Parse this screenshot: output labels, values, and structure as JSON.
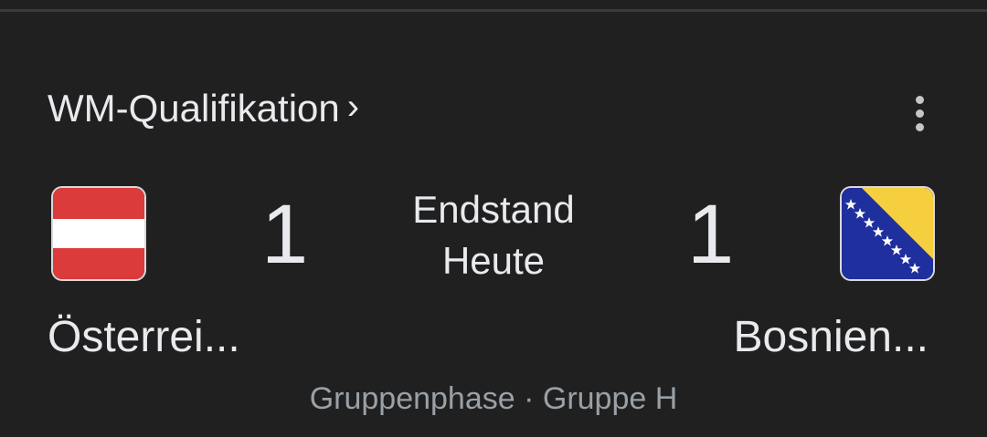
{
  "competition": {
    "label": "WM-Qualifikation",
    "chevron": "›"
  },
  "menu": {
    "icon": "more-vert-icon"
  },
  "match": {
    "home": {
      "name": "Österrei...",
      "score": "1",
      "flag_icon": "austria-flag-icon",
      "flag_colors": {
        "red": "#dc3b3b",
        "white": "#ffffff"
      }
    },
    "away": {
      "name": "Bosnien...",
      "score": "1",
      "flag_icon": "bosnia-herzegovina-flag-icon",
      "flag_colors": {
        "blue": "#1f2f9e",
        "yellow": "#f6cf3f",
        "stars": "#ffffff"
      }
    },
    "status": {
      "line1": "Endstand",
      "line2": "Heute"
    },
    "stage": "Gruppenphase · Gruppe H"
  }
}
